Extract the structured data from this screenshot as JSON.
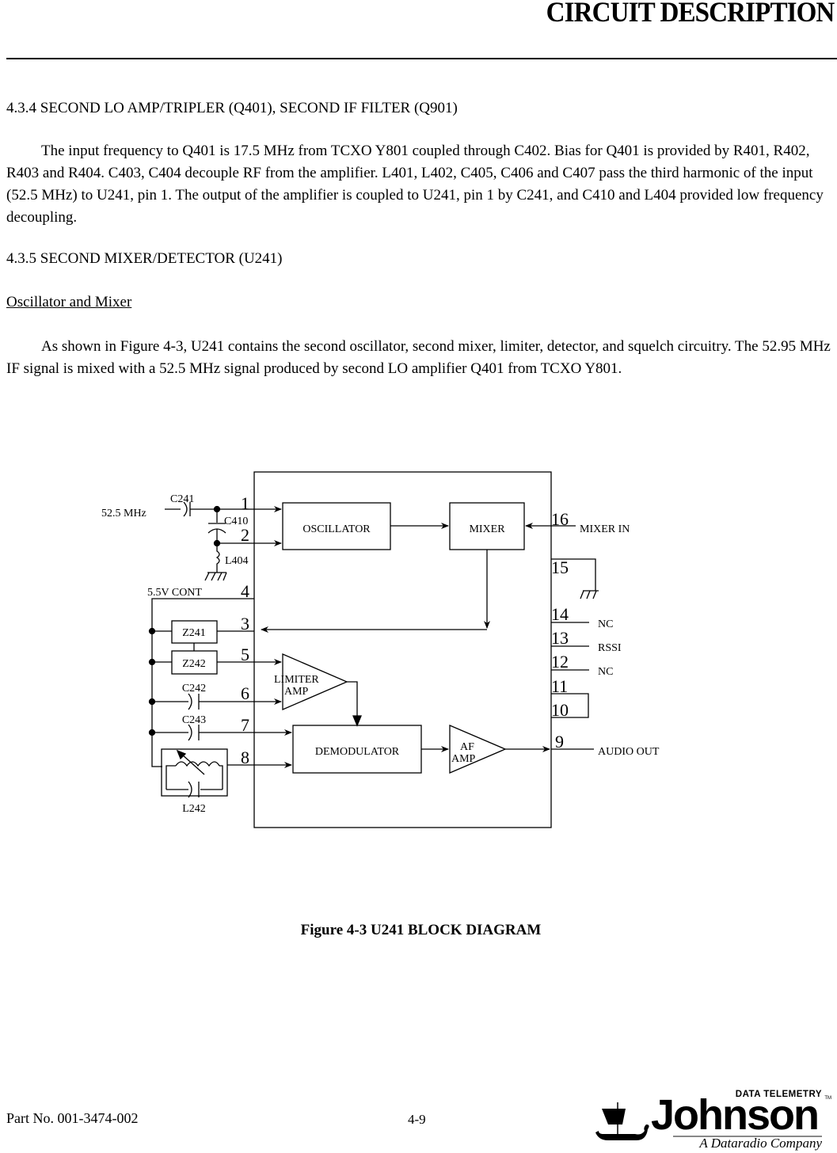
{
  "header": {
    "title": "CIRCUIT DESCRIPTION"
  },
  "section_434": {
    "heading": "4.3.4  SECOND LO AMP/TRIPLER (Q401), SECOND IF FILTER (Q901)",
    "paragraph": "The input frequency to Q401 is 17.5 MHz from TCXO Y801 coupled through C402. Bias for Q401 is provided by R401, R402, R403 and R404. C403, C404 decouple RF from the amplifier. L401, L402, C405, C406 and C407 pass the third harmonic of the input (52.5 MHz) to U241, pin 1. The output of the amplifier is coupled to U241, pin 1 by C241, and C410 and L404 provided low frequency decoupling."
  },
  "section_435": {
    "heading": "4.3.5  SECOND MIXER/DETECTOR (U241)",
    "subheading": "Oscillator and Mixer",
    "paragraph": "As shown in Figure 4-3, U241 contains the second oscillator, second mixer, limiter, detector, and squelch circuitry. The 52.95 MHz IF signal is mixed with a 52.5 MHz signal produced by second LO amplifier Q401 from TCXO Y801."
  },
  "diagram": {
    "blocks": {
      "oscillator": "OSCILLATOR",
      "mixer": "MIXER",
      "limiter_line1": "LIMITER",
      "limiter_line2": "AMP",
      "demodulator": "DEMODULATOR",
      "af_line1": "AF",
      "af_line2": "AMP"
    },
    "pins": [
      "1",
      "2",
      "3",
      "4",
      "5",
      "6",
      "7",
      "8",
      "9",
      "10",
      "11",
      "12",
      "13",
      "14",
      "15",
      "16"
    ],
    "components": {
      "c241": "C241",
      "c410": "C410",
      "l404": "L404",
      "z241": "Z241",
      "z242": "Z242",
      "c242": "C242",
      "c243": "C243",
      "l242": "L242"
    },
    "signals": {
      "input_freq": "52.5 MHz",
      "cont": "5.5V CONT",
      "mixer_in": "MIXER IN",
      "nc_14": "NC",
      "rssi": "RSSI",
      "nc_12": "NC",
      "audio_out": "AUDIO OUT"
    }
  },
  "figure_caption": "Figure 4-3   U241 BLOCK DIAGRAM",
  "footer": {
    "page_number": "4-9",
    "part_number": "Part No. 001-3474-002",
    "logo": {
      "tagline_top": "DATA TELEMETRY",
      "brand": "Johnson",
      "trademark": "TM",
      "tagline_bottom": "A Dataradio Company"
    }
  }
}
